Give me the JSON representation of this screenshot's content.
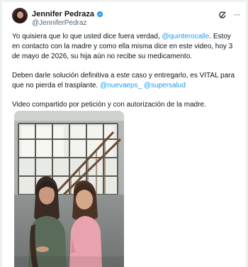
{
  "author": {
    "name": "Jennifer Pedraza",
    "handle": "@JenniferPedraz",
    "verified": true,
    "avatar_icon": "profile-photo"
  },
  "actions": {
    "grok_icon": "grok-icon",
    "more_icon": "more-options-icon",
    "more_glyph": "···"
  },
  "post": {
    "p1_a": "Yo quisiera que lo que usted dice fuera verdad, ",
    "p1_mention": "@quinterocalle",
    "p1_b": ". Estoy en contacto con la madre y como ella misma dice en este video, hoy 3 de mayo de 2026, su hija aún no recibe su medicamento.",
    "p2_a": "Deben darle solución definitiva a este caso y entregarlo, es VITAL para que no pierda el trasplante. ",
    "p2_mention1": "@nuevaeps_",
    "p2_space": " ",
    "p2_mention2": "@supersalud",
    "p3": "Video compartido por petición y con autorización de la madre."
  },
  "colors": {
    "link": "#1d9bf0",
    "text": "#0f1419",
    "secondary": "#536471",
    "verified": "#1d9bf0"
  }
}
